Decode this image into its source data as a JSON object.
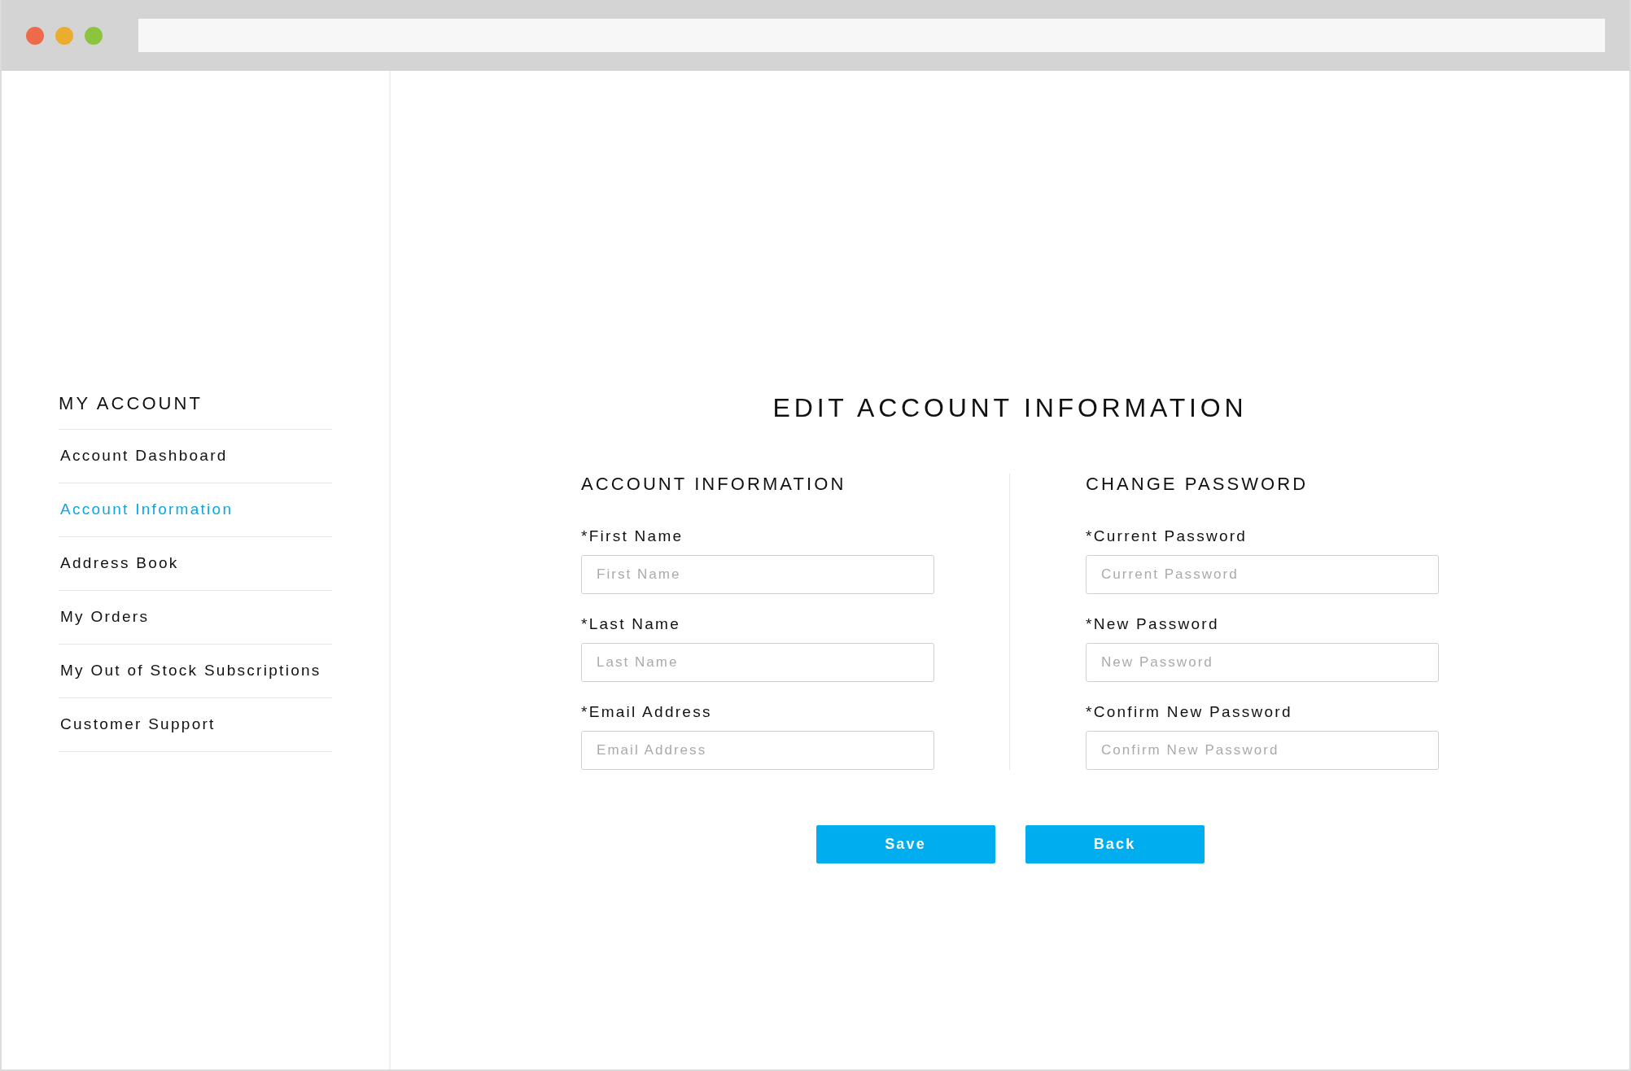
{
  "sidebar": {
    "heading": "MY ACCOUNT",
    "items": [
      {
        "label": "Account Dashboard",
        "selected": false
      },
      {
        "label": "Account Information",
        "selected": true
      },
      {
        "label": "Address Book",
        "selected": false
      },
      {
        "label": "My Orders",
        "selected": false
      },
      {
        "label": "My Out of Stock Subscriptions",
        "selected": false
      },
      {
        "label": "Customer Support",
        "selected": false
      }
    ]
  },
  "main": {
    "title": "EDIT ACCOUNT INFORMATION",
    "sections": [
      {
        "heading": "ACCOUNT INFORMATION",
        "fields": [
          {
            "label": "*First Name",
            "placeholder": "First Name"
          },
          {
            "label": "*Last Name",
            "placeholder": "Last Name"
          },
          {
            "label": "*Email Address",
            "placeholder": "Email Address"
          }
        ]
      },
      {
        "heading": "CHANGE PASSWORD",
        "fields": [
          {
            "label": "*Current Password",
            "placeholder": "Current Password"
          },
          {
            "label": "*New Password",
            "placeholder": "New Password"
          },
          {
            "label": "*Confirm New Password",
            "placeholder": "Confirm New Password"
          }
        ]
      }
    ],
    "buttons": [
      "Save",
      "Back"
    ]
  }
}
